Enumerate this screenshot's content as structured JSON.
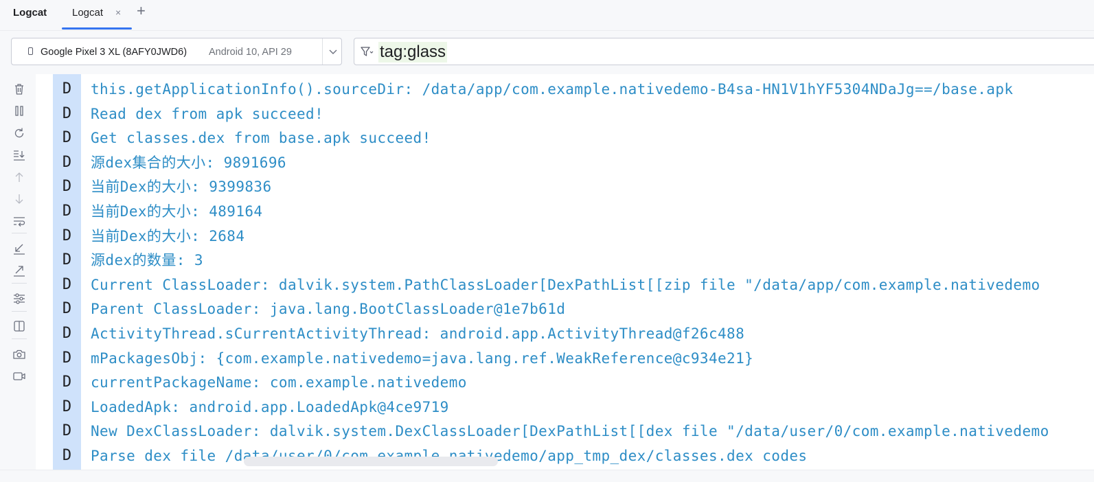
{
  "toolwindow": {
    "title": "Logcat"
  },
  "tabs": [
    {
      "label": "Logcat",
      "close": "×"
    }
  ],
  "add_tab": "+",
  "device": {
    "name": "Google Pixel 3 XL (8AFY0JWD6)",
    "api": "Android 10, API 29",
    "icon": "phone-icon"
  },
  "filter": {
    "query": "tag:glass",
    "icon": "filter-icon"
  },
  "toolbar_icons": [
    "trash-icon",
    "pause-icon",
    "restart-icon",
    "scroll-to-end-icon",
    "arrow-up-icon",
    "arrow-down-icon",
    "soft-wrap-icon",
    "fold-icon",
    "unfold-icon",
    "settings-icon",
    "split-panels-icon",
    "screenshot-icon",
    "screen-record-icon"
  ],
  "log_rows": [
    {
      "level": "D",
      "message": "this.getApplicationInfo().sourceDir: /data/app/com.example.nativedemo-B4sa-HN1V1hYF5304NDaJg==/base.apk"
    },
    {
      "level": "D",
      "message": "Read dex from apk succeed!"
    },
    {
      "level": "D",
      "message": "Get classes.dex from base.apk succeed!"
    },
    {
      "level": "D",
      "message": "源dex集合的大小: 9891696"
    },
    {
      "level": "D",
      "message": "当前Dex的大小: 9399836"
    },
    {
      "level": "D",
      "message": "当前Dex的大小: 489164"
    },
    {
      "level": "D",
      "message": "当前Dex的大小: 2684"
    },
    {
      "level": "D",
      "message": "源dex的数量: 3"
    },
    {
      "level": "D",
      "message": "Current ClassLoader: dalvik.system.PathClassLoader[DexPathList[[zip file \"/data/app/com.example.nativedemo"
    },
    {
      "level": "D",
      "message": "Parent ClassLoader: java.lang.BootClassLoader@1e7b61d"
    },
    {
      "level": "D",
      "message": "ActivityThread.sCurrentActivityThread: android.app.ActivityThread@f26c488"
    },
    {
      "level": "D",
      "message": "mPackagesObj: {com.example.nativedemo=java.lang.ref.WeakReference@c934e21}"
    },
    {
      "level": "D",
      "message": "currentPackageName: com.example.nativedemo"
    },
    {
      "level": "D",
      "message": "LoadedApk: android.app.LoadedApk@4ce9719"
    },
    {
      "level": "D",
      "message": "New DexClassLoader: dalvik.system.DexClassLoader[DexPathList[[dex file \"/data/user/0/com.example.nativedemo"
    },
    {
      "level": "D",
      "message": "Parse dex file /data/user/0/com.example.nativedemo/app_tmp_dex/classes.dex codes"
    }
  ],
  "colors": {
    "accent": "#3574f0",
    "debug_text": "#2d8dc6",
    "level_column": "#cfe2fb",
    "filter_highlight": "#edf7e8"
  }
}
